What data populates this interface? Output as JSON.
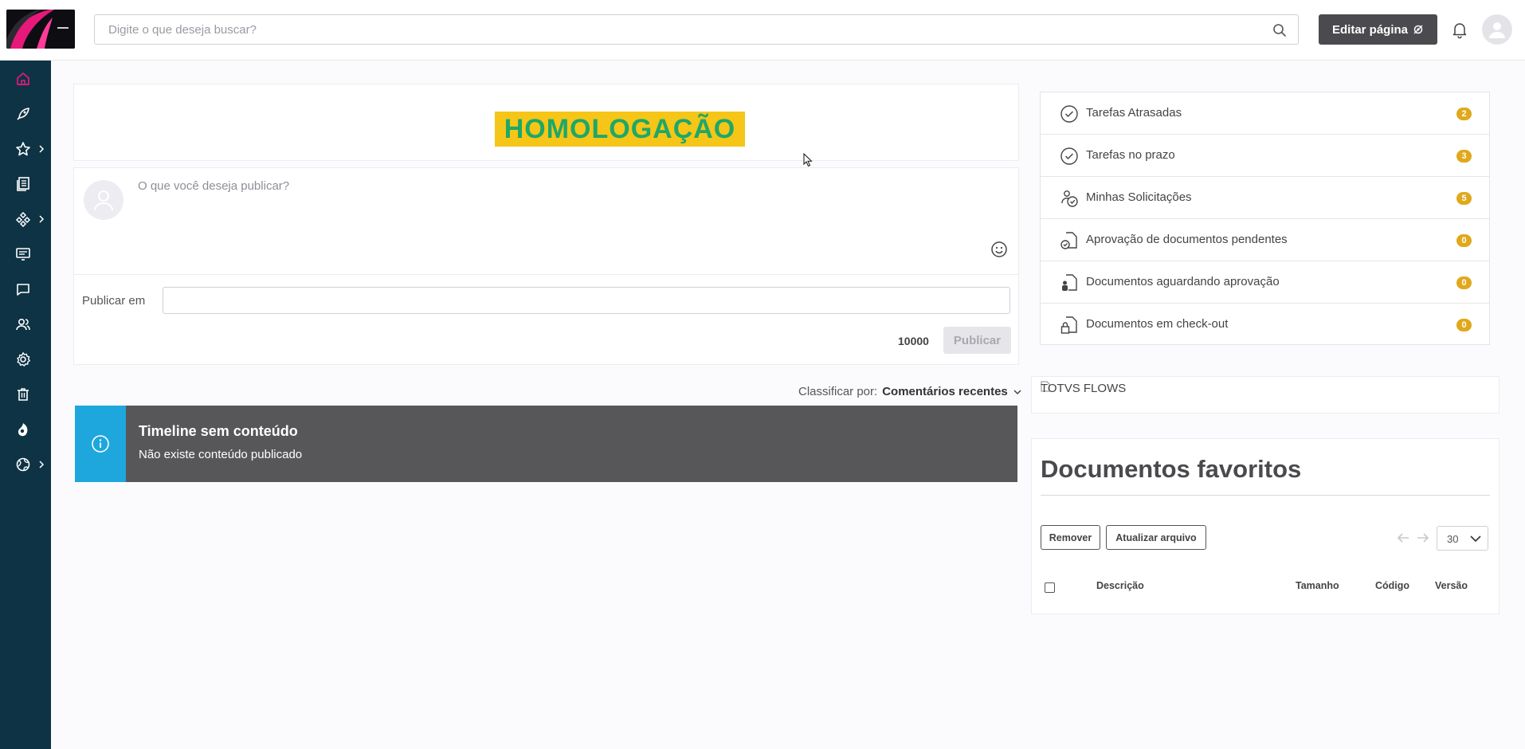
{
  "header": {
    "search_placeholder": "Digite o que deseja buscar?",
    "edit_button_label": "Editar página"
  },
  "sidebar": {
    "items": [
      {
        "icon": "home-icon",
        "has_submenu": false,
        "active": true
      },
      {
        "icon": "rocket-icon",
        "has_submenu": false
      },
      {
        "icon": "star-icon",
        "has_submenu": true
      },
      {
        "icon": "documents-icon",
        "has_submenu": false
      },
      {
        "icon": "workflow-icon",
        "has_submenu": true
      },
      {
        "icon": "presentation-icon",
        "has_submenu": false
      },
      {
        "icon": "chat-icon",
        "has_submenu": false
      },
      {
        "icon": "users-icon",
        "has_submenu": false
      },
      {
        "icon": "gear-icon",
        "has_submenu": false
      },
      {
        "icon": "trash-icon",
        "has_submenu": false
      },
      {
        "icon": "fluig-icon",
        "has_submenu": false
      },
      {
        "icon": "globe-icon",
        "has_submenu": true
      }
    ]
  },
  "main": {
    "banner": "HOMOLOGAÇÃO",
    "post": {
      "placeholder": "O que você deseja publicar?",
      "publish_in_label": "Publicar em",
      "char_count": "10000",
      "publish_button": "Publicar"
    },
    "sort": {
      "label": "Classificar por:",
      "value": "Comentários recentes"
    },
    "timeline": {
      "title": "Timeline sem conteúdo",
      "message": "Não existe conteúdo publicado"
    }
  },
  "tasks": [
    {
      "label": "Tarefas Atrasadas",
      "count": "2",
      "icon": "clock-check-icon"
    },
    {
      "label": "Tarefas no prazo",
      "count": "3",
      "icon": "clock-check-icon"
    },
    {
      "label": "Minhas Solicitações",
      "count": "5",
      "icon": "user-clock-icon"
    },
    {
      "label": "Aprovação de documentos pendentes",
      "count": "0",
      "icon": "document-clock-icon"
    },
    {
      "label": "Documentos aguardando aprovação",
      "count": "0",
      "icon": "document-user-icon"
    },
    {
      "label": "Documentos em check-out",
      "count": "0",
      "icon": "document-lock-icon"
    }
  ],
  "flows_image_alt": "TOTVS FLOWS",
  "favorites": {
    "title": "Documentos favoritos",
    "remove_button": "Remover",
    "update_button": "Atualizar arquivo",
    "page_size": "30",
    "columns": [
      "Descrição",
      "Tamanho",
      "Código",
      "Versão"
    ]
  },
  "colors": {
    "sidebar_bg": "#0e3345",
    "sidebar_active": "#e6197a",
    "banner_bg": "#f5c518",
    "banner_text": "#1da867",
    "timeline_bg": "#575759",
    "timeline_accent": "#1ea7dc",
    "badge": "#e0a81b",
    "edit_button_bg": "#4b4b4f"
  }
}
